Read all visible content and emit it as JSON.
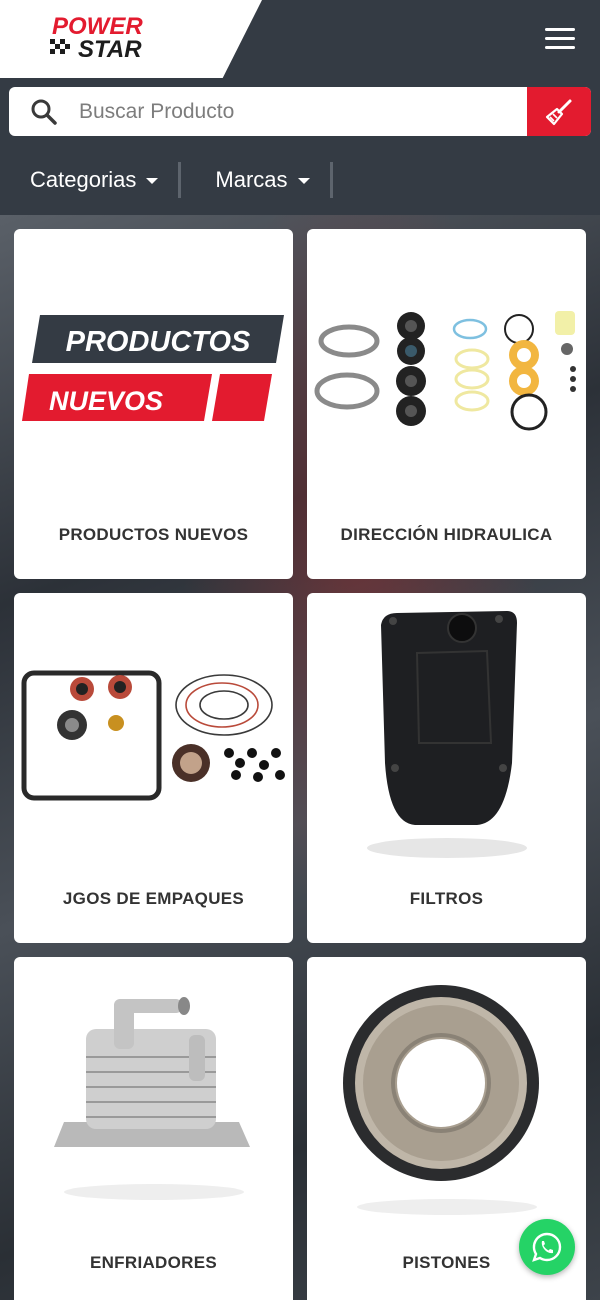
{
  "brand": {
    "logo_line1": "POWER",
    "logo_line2": "STAR"
  },
  "header": {
    "menu_icon": "hamburger-menu-icon"
  },
  "search": {
    "placeholder": "Buscar Producto",
    "value": "",
    "search_icon": "search-icon",
    "clear_icon": "broom-icon"
  },
  "filters": [
    {
      "label": "Categorias"
    },
    {
      "label": "Marcas"
    }
  ],
  "categories": [
    {
      "label": "PRODUCTOS NUEVOS",
      "banner_top": "PRODUCTOS",
      "banner_bottom": "NUEVOS"
    },
    {
      "label": "DIRECCIÓN HIDRAULICA"
    },
    {
      "label": "JGOS DE EMPAQUES"
    },
    {
      "label": "FILTROS"
    },
    {
      "label": "ENFRIADORES"
    },
    {
      "label": "PISTONES"
    }
  ],
  "whatsapp": {
    "icon": "whatsapp-icon"
  },
  "colors": {
    "brand_red": "#e31b2f",
    "header_bg": "#343b44",
    "whatsapp": "#25d366"
  }
}
